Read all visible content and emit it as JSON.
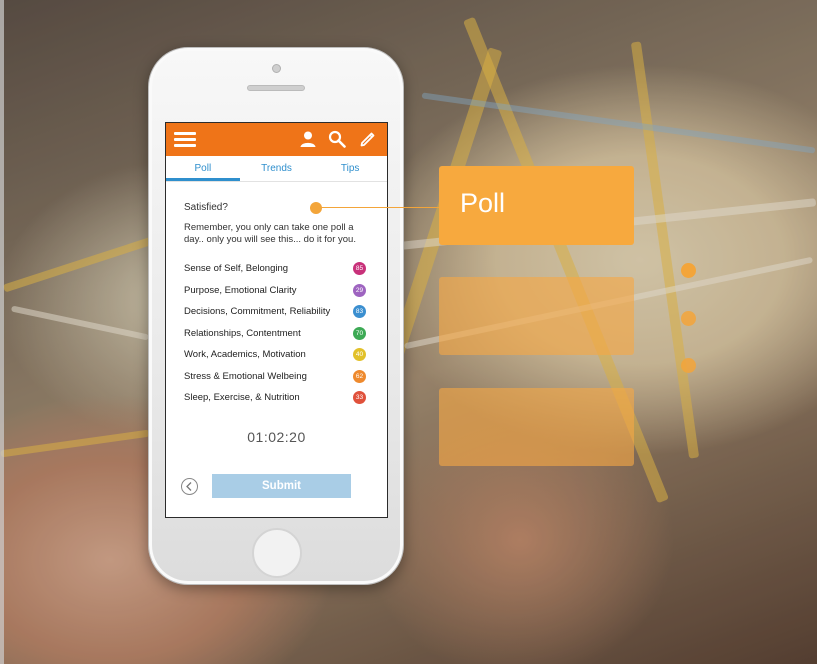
{
  "app": {
    "tabs": [
      "Poll",
      "Trends",
      "Tips"
    ],
    "active_tab": "Poll",
    "accent_color": "#ef7418",
    "tab_color": "#2f8fcd",
    "icons": [
      "menu-icon",
      "user-icon",
      "search-icon",
      "edit-icon"
    ]
  },
  "poll": {
    "question": "Satisfied?",
    "note": "Remember, you only can take one poll a day.. only you will see this... do it for you.",
    "items": [
      {
        "label": "Sense of Self, Belonging",
        "score": "85",
        "color": "#c8317a"
      },
      {
        "label": "Purpose, Emotional Clarity",
        "score": "29",
        "color": "#9e64c0"
      },
      {
        "label": "Decisions, Commitment, Reliability",
        "score": "83",
        "color": "#3b8fd0"
      },
      {
        "label": "Relationships, Contentment",
        "score": "70",
        "color": "#3daa55"
      },
      {
        "label": "Work, Academics, Motivation",
        "score": "40",
        "color": "#e2c12a"
      },
      {
        "label": "Stress & Emotional Welbeing",
        "score": "62",
        "color": "#ee8a2e"
      },
      {
        "label": "Sleep, Exercise, & Nutrition",
        "score": "33",
        "color": "#e0513b"
      }
    ],
    "timer": "01:02:20",
    "submit_label": "Submit"
  },
  "callout": {
    "title": "Poll",
    "color": "#f7a93e"
  }
}
